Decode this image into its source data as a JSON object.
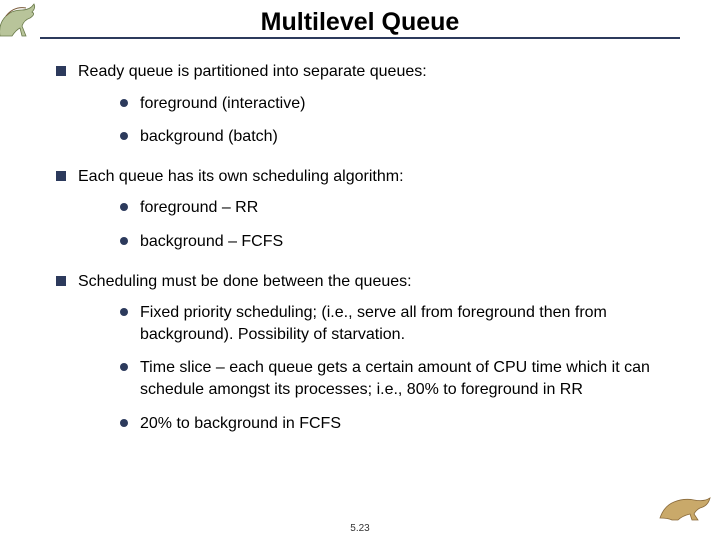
{
  "title": "Multilevel Queue",
  "points": [
    {
      "text": "Ready queue is partitioned into separate queues:",
      "sub": [
        "foreground (interactive)",
        "background (batch)"
      ]
    },
    {
      "text": "Each queue has its own scheduling algorithm:",
      "sub": [
        "foreground – RR",
        "background – FCFS"
      ]
    },
    {
      "text": "Scheduling must be done between the queues:",
      "sub": [
        "Fixed priority scheduling; (i.e., serve all from foreground then from background).  Possibility of starvation.",
        "Time slice – each queue gets a certain amount of CPU time which it can schedule amongst its processes; i.e., 80% to foreground in RR",
        "20% to background in FCFS"
      ]
    }
  ],
  "footer": "5.23"
}
